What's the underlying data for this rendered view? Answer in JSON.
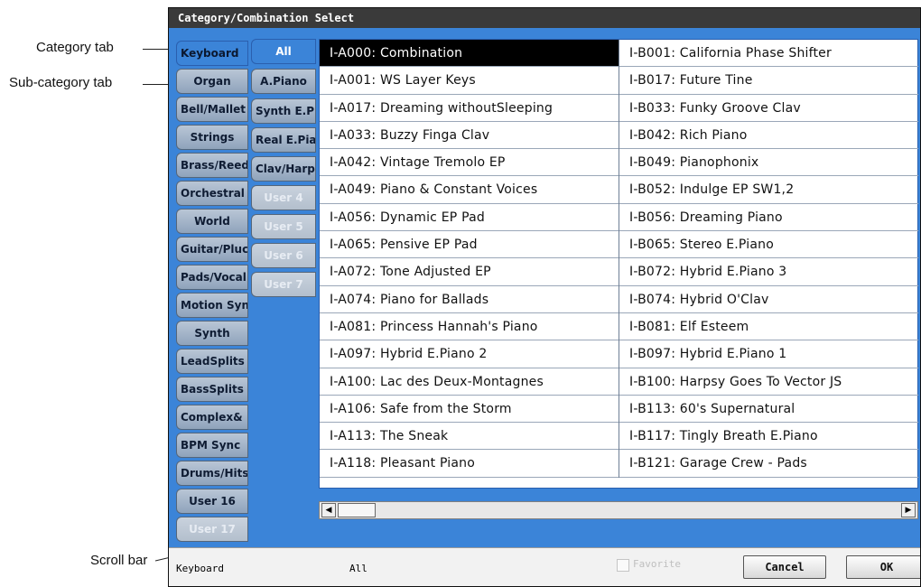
{
  "callouts": {
    "category_tab": "Category tab",
    "subcategory_tab": "Sub-category tab",
    "scroll_bar": "Scroll bar"
  },
  "window": {
    "title": "Category/Combination Select"
  },
  "category_tabs": [
    {
      "label": "Keyboard"
    },
    {
      "label": "Organ"
    },
    {
      "label": "Bell/Mallet"
    },
    {
      "label": "Strings"
    },
    {
      "label": "Brass/Reed"
    },
    {
      "label": "Orchestral"
    },
    {
      "label": "World"
    },
    {
      "label": "Guitar/Plucked"
    },
    {
      "label": "Pads/Vocal"
    },
    {
      "label": "Motion Synth"
    },
    {
      "label": "Synth"
    },
    {
      "label": "LeadSplits"
    },
    {
      "label": "BassSplits"
    },
    {
      "label": "Complex&"
    },
    {
      "label": "BPM Sync"
    },
    {
      "label": "Drums/Hits"
    },
    {
      "label": "User 16"
    },
    {
      "label": "User 17"
    }
  ],
  "subcategory_tabs": [
    {
      "label": "All"
    },
    {
      "label": "A.Piano"
    },
    {
      "label": "Synth E.Piano"
    },
    {
      "label": "Real E.Piano"
    },
    {
      "label": "Clav/Harpsi"
    },
    {
      "label": "User 4"
    },
    {
      "label": "User 5"
    },
    {
      "label": "User 6"
    },
    {
      "label": "User 7"
    }
  ],
  "list": {
    "left": [
      "I-A000: Combination",
      "I-A001: WS Layer Keys",
      "I-A017: Dreaming withoutSleeping",
      "I-A033: Buzzy Finga Clav",
      "I-A042: Vintage Tremolo EP",
      "I-A049: Piano & Constant Voices",
      "I-A056: Dynamic EP Pad",
      "I-A065: Pensive EP Pad",
      "I-A072: Tone Adjusted EP",
      "I-A074: Piano for Ballads",
      "I-A081: Princess Hannah's Piano",
      "I-A097: Hybrid E.Piano 2",
      "I-A100: Lac des Deux-Montagnes",
      "I-A106: Safe from the Storm",
      "I-A113: The Sneak",
      "I-A118: Pleasant Piano"
    ],
    "right": [
      "I-B001: California Phase Shifter",
      "I-B017: Future Tine",
      "I-B033: Funky Groove Clav",
      "I-B042: Rich Piano",
      "I-B049: Pianophonix",
      "I-B052: Indulge EP SW1,2",
      "I-B056: Dreaming Piano",
      "I-B065: Stereo E.Piano",
      "I-B072: Hybrid E.Piano 3",
      "I-B074: Hybrid O'Clav",
      "I-B081: Elf Esteem",
      "I-B097: Hybrid E.Piano 1",
      "I-B100: Harpsy Goes To Vector JS",
      "I-B113: 60's Supernatural",
      "I-B117: Tingly Breath E.Piano",
      "I-B121: Garage Crew - Pads"
    ]
  },
  "scrollbar": {
    "left_arrow": "◀",
    "right_arrow": "▶"
  },
  "bottom": {
    "category": "Keyboard",
    "subcategory": "All",
    "favorite_label": "Favorite",
    "cancel_label": "Cancel",
    "ok_label": "OK"
  }
}
